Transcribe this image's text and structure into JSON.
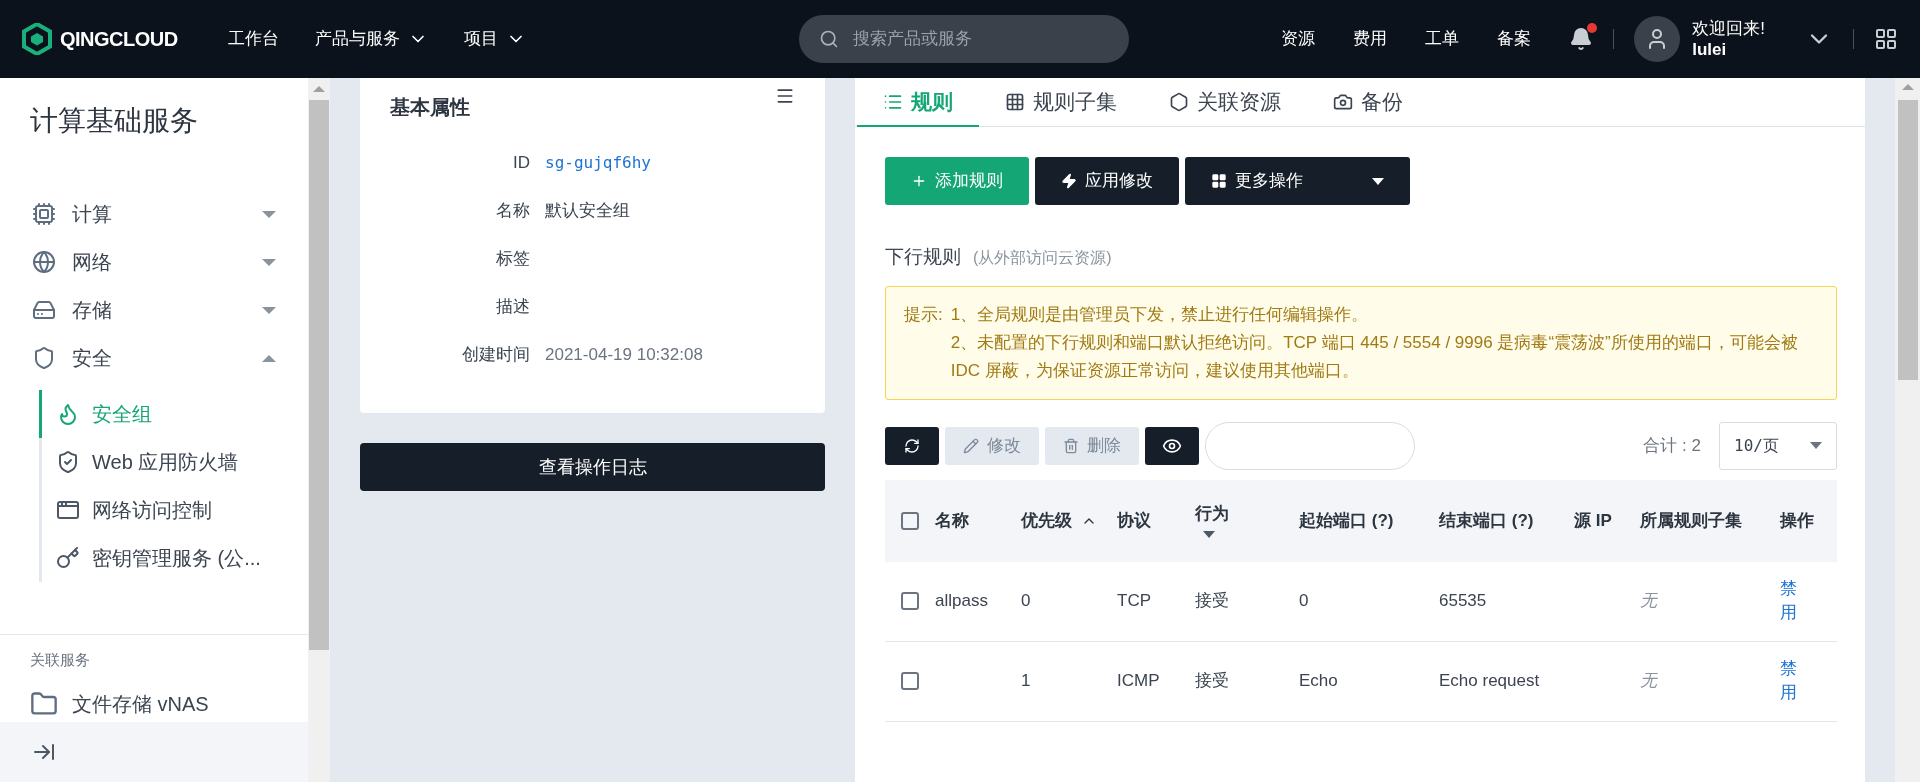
{
  "header": {
    "logo": "QINGCLOUD",
    "nav": [
      {
        "label": "工作台",
        "dropdown": false
      },
      {
        "label": "产品与服务",
        "dropdown": true
      },
      {
        "label": "项目",
        "dropdown": true
      }
    ],
    "search": {
      "placeholder": "搜索产品或服务"
    },
    "links": [
      "资源",
      "费用",
      "工单",
      "备案"
    ],
    "notification": {
      "unread": true
    },
    "user": {
      "greeting": "欢迎回来!",
      "name": "lulei"
    }
  },
  "sidebar": {
    "title": "计算基础服务",
    "items": [
      {
        "label": "计算",
        "expanded": false
      },
      {
        "label": "网络",
        "expanded": false
      },
      {
        "label": "存储",
        "expanded": false
      },
      {
        "label": "安全",
        "expanded": true,
        "children": [
          {
            "label": "安全组",
            "selected": true
          },
          {
            "label": "Web 应用防火墙",
            "selected": false
          },
          {
            "label": "网络访问控制",
            "selected": false
          },
          {
            "label": "密钥管理服务 (公...",
            "selected": false
          }
        ]
      }
    ],
    "related_title": "关联服务",
    "related": [
      {
        "label": "文件存储 vNAS"
      }
    ]
  },
  "properties": {
    "title": "基本属性",
    "rows": [
      {
        "label": "ID",
        "value": "sg-gujqf6hy",
        "kind": "link"
      },
      {
        "label": "名称",
        "value": "默认安全组",
        "kind": "text"
      },
      {
        "label": "标签"
      },
      {
        "label": "描述"
      },
      {
        "label": "创建时间",
        "value": "2021-04-19 10:32:08",
        "kind": "muted"
      }
    ],
    "log_button": "查看操作日志"
  },
  "tabs": [
    {
      "label": "规则",
      "selected": true
    },
    {
      "label": "规则子集",
      "selected": false
    },
    {
      "label": "关联资源",
      "selected": false
    },
    {
      "label": "备份",
      "selected": false
    }
  ],
  "actions": [
    {
      "label": "添加规则",
      "kind": "primary"
    },
    {
      "label": "应用修改",
      "kind": "dark"
    },
    {
      "label": "更多操作",
      "kind": "menu"
    }
  ],
  "section": {
    "title": "下行规则",
    "subtitle": "(从外部访问云资源)"
  },
  "notice": {
    "prefix": "提示:",
    "lines": [
      "1、全局规则是由管理员下发，禁止进行任何编辑操作。",
      "2、未配置的下行规则和端口默认拒绝访问。TCP 端口 445 / 5554 / 9996 是病毒“震荡波”所使用的端口，可能会被 IDC 屏蔽，为保证资源正常访问，建议使用其他端口。"
    ]
  },
  "toolbar": {
    "buttons": [
      {
        "label": "修改",
        "disabled": true
      },
      {
        "label": "删除",
        "disabled": true
      }
    ],
    "total": "合计 : 2",
    "page_size": "10/页"
  },
  "table": {
    "all_checked": false,
    "columns": [
      {
        "label": "名称"
      },
      {
        "label": "优先级",
        "sorted": true
      },
      {
        "label": "协议"
      },
      {
        "label": "行为",
        "filter": true
      },
      {
        "label": "起始端口 (?)"
      },
      {
        "label": "结束端口 (?)"
      },
      {
        "label": "源 IP"
      },
      {
        "label": "所属规则子集"
      },
      {
        "label": "操作"
      }
    ],
    "rows": [
      {
        "checked": false,
        "cells": [
          "allpass",
          "0",
          "TCP",
          "接受",
          "0",
          "65535",
          "",
          "无"
        ],
        "action": "禁用"
      },
      {
        "checked": false,
        "cells": [
          "",
          "1",
          "ICMP",
          "接受",
          "Echo",
          "Echo request",
          "",
          "无"
        ],
        "action": "禁用"
      }
    ]
  }
}
